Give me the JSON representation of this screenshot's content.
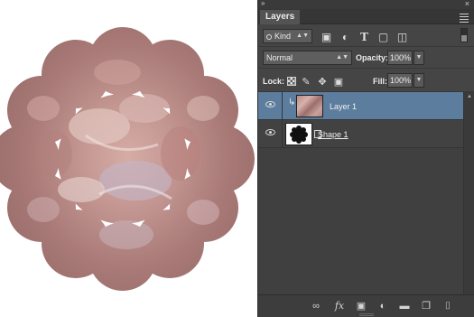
{
  "panel": {
    "tab_label": "Layers",
    "kind_label": "Kind",
    "blend_mode": "Normal",
    "opacity_label": "Opacity:",
    "opacity_value": "100%",
    "lock_label": "Lock:",
    "fill_label": "Fill:",
    "fill_value": "100%"
  },
  "layers": [
    {
      "name": "Layer 1",
      "selected": true,
      "clipped": true
    },
    {
      "name": "Shape 1",
      "selected": false,
      "clipped": false
    }
  ],
  "colors": {
    "panel_bg": "#454545",
    "selection": "#5c7d9d",
    "petal_base": "#b58c88"
  },
  "icons": {
    "filter": [
      "image-filter-icon",
      "adjustment-filter-icon",
      "type-filter-icon",
      "shape-filter-icon",
      "smart-object-filter-icon"
    ],
    "lock": [
      "lock-transparent-pixels-icon",
      "lock-image-pixels-icon",
      "lock-position-icon",
      "lock-all-icon"
    ],
    "bottom": [
      "link-layers-icon",
      "fx-icon",
      "add-mask-icon",
      "adjustment-layer-icon",
      "new-group-icon",
      "new-layer-icon",
      "delete-layer-icon"
    ]
  }
}
